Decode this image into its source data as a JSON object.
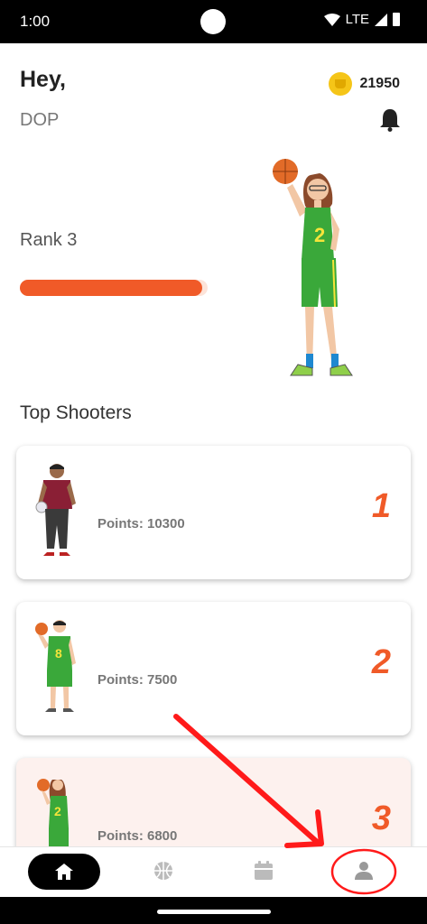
{
  "status": {
    "time": "1:00",
    "network": "LTE"
  },
  "header": {
    "greeting": "Hey,",
    "username": "DOP",
    "coins": "21950"
  },
  "rank": {
    "label": "Rank 3",
    "progress": 0.97
  },
  "top_shooters": {
    "title": "Top Shooters",
    "items": [
      {
        "points": "Points: 10300",
        "rank": "1",
        "highlight": false
      },
      {
        "points": "Points: 7500",
        "rank": "2",
        "highlight": false
      },
      {
        "points": "Points: 6800",
        "rank": "3",
        "highlight": true
      }
    ]
  },
  "nav": {
    "items": [
      "home-icon",
      "basketball-icon",
      "calendar-icon",
      "profile-icon"
    ],
    "active": "home-icon"
  },
  "colors": {
    "accent": "#f05a28",
    "annotation": "#ff1a1a",
    "jersey": "#3aa83a"
  }
}
